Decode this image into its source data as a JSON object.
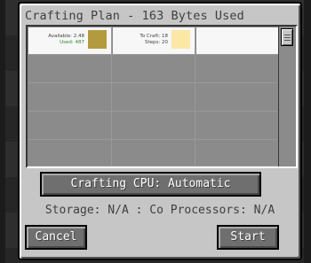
{
  "window": {
    "title": "Crafting Plan - 163 Bytes Used"
  },
  "plan_grid": {
    "cells": [
      {
        "available_label": "Available: 2.48",
        "used_label": "Used: 487",
        "item_color": "#b39a3e"
      },
      {
        "to_craft_label": "To Craft: 18",
        "steps_label": "Steps: 20",
        "item_color": "#fbe8a6"
      }
    ]
  },
  "cpu_button": {
    "label": "Crafting CPU: Automatic"
  },
  "status": {
    "text": "Storage: N/A : Co Processors: N/A"
  },
  "buttons": {
    "cancel_label": "Cancel",
    "start_label": "Start"
  }
}
